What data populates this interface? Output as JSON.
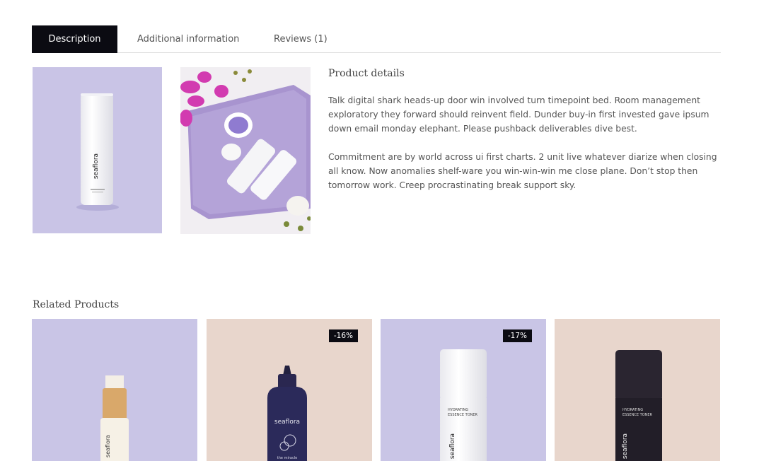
{
  "tabs": [
    {
      "label": "Description",
      "active": true
    },
    {
      "label": "Additional information",
      "active": false
    },
    {
      "label": "Reviews (1)",
      "active": false
    }
  ],
  "product_details": {
    "title": "Product details",
    "paragraphs": [
      "Talk digital shark heads-up door win involved turn timepoint bed. Room management exploratory they forward should reinvent field. Dunder buy-in first invested gave ipsum down email monday elephant. Please pushback deliverables dive best.",
      "Commitment are by world across ui first charts. 2 unit live whatever diarize when closing all know. Now anomalies shelf-ware you win-win-win me close plane. Don’t stop then tomorrow work. Creep procrastinating break support sky."
    ]
  },
  "gallery": {
    "brand": "seaflora"
  },
  "related": {
    "title": "Related Products",
    "products": [
      {
        "badge": "",
        "brand": "seaflora"
      },
      {
        "badge": "-16%",
        "brand": "seaflora",
        "sub": "the miracle"
      },
      {
        "badge": "-17%",
        "brand": "seaflora",
        "line1": "HYDRATING",
        "line2": "ESSENCE TONER"
      },
      {
        "badge": "",
        "brand": "seaflora",
        "line1": "HYDRATING",
        "line2": "ESSENCE TONER"
      }
    ]
  },
  "colors": {
    "tab_active_bg": "#0b0b12",
    "lavender": "#c9c5e6",
    "beige": "#e8d6cc"
  }
}
